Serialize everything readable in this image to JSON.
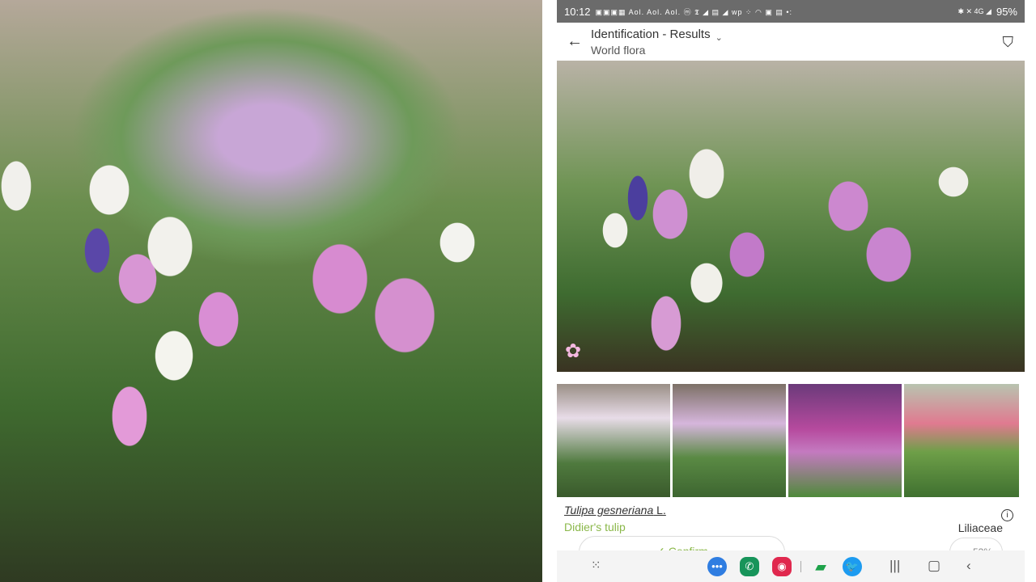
{
  "status_bar": {
    "time": "10:12",
    "notification_icons": "▣▣▣▦ Aol. Aol. Aol. ⓜ 𝕿 ◢ ▤ ◢ wp ⁘ ◠ ▣ ▤ •:",
    "right_icons": "✱ ✕ 4G ◢",
    "battery": "95%"
  },
  "header": {
    "title": "Identification - Results",
    "subtitle": "World flora",
    "back_icon": "arrow-left",
    "filter_icon": "filter"
  },
  "result": {
    "scientific_name": "Tulipa gesneriana",
    "author": " L.",
    "common_name": "Didier's tulip",
    "family": "Liliaceae",
    "confirm_label": "✓ Confirm",
    "score": "53%"
  },
  "dock": {
    "apps": [
      "messages",
      "phone",
      "camera",
      "chat",
      "twitter"
    ]
  }
}
